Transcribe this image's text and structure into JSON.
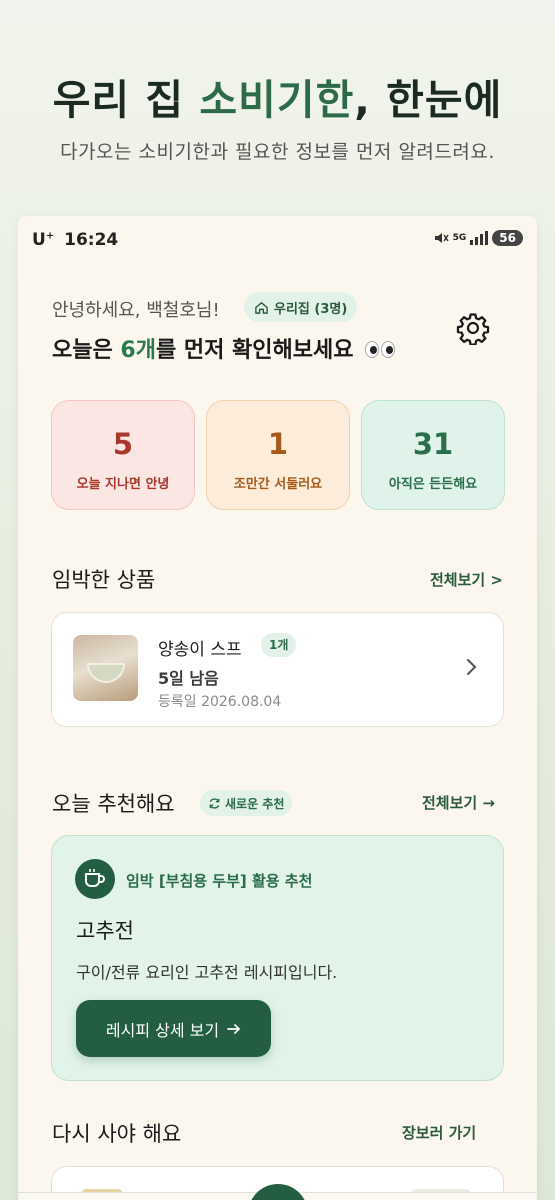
{
  "promo": {
    "title_prefix": "우리 집 ",
    "title_accent": "소비기한",
    "title_suffix": ", 한눈에",
    "subtitle": "다가오는 소비기한과 필요한 정보를 먼저 알려드려요."
  },
  "status_bar": {
    "carrier": "U",
    "carrier_sup": "+",
    "time": "16:24",
    "network": "5G",
    "battery": "56"
  },
  "header": {
    "greeting": "안녕하세요, 백철호님!",
    "household_chip": "우리집 (3명)",
    "headline_prefix": "오늘은 ",
    "headline_count": "6개",
    "headline_suffix": "를 먼저 확인해보세요"
  },
  "stats": [
    {
      "value": "5",
      "label": "오늘 지나면 안녕",
      "color": "#a8382c"
    },
    {
      "value": "1",
      "label": "조만간 서둘러요",
      "color": "#a55a1b"
    },
    {
      "value": "31",
      "label": "아직은 든든해요",
      "color": "#2a6e4b"
    }
  ],
  "imminent": {
    "title": "임박한 상품",
    "see_all": "전체보기 >",
    "item": {
      "name": "양송이 스프",
      "qty": "1개",
      "days_left": "5일 남음",
      "registered": "등록일 2026.08.04"
    }
  },
  "recommend": {
    "title": "오늘 추천해요",
    "new_chip": "새로운 추천",
    "see_all": "전체보기 →",
    "tag": "임박 [부침용 두부] 활용 추천",
    "recipe_title": "고추전",
    "recipe_desc": "구이/전류 요리인 고추전 레시피입니다.",
    "button": "레시피 상세 보기"
  },
  "rebuy": {
    "title": "다시 사야 해요",
    "link": "장보러 가기"
  },
  "colors": {
    "accent": "#2d6a47",
    "button": "#245e42",
    "background": "#fbf7ee"
  }
}
